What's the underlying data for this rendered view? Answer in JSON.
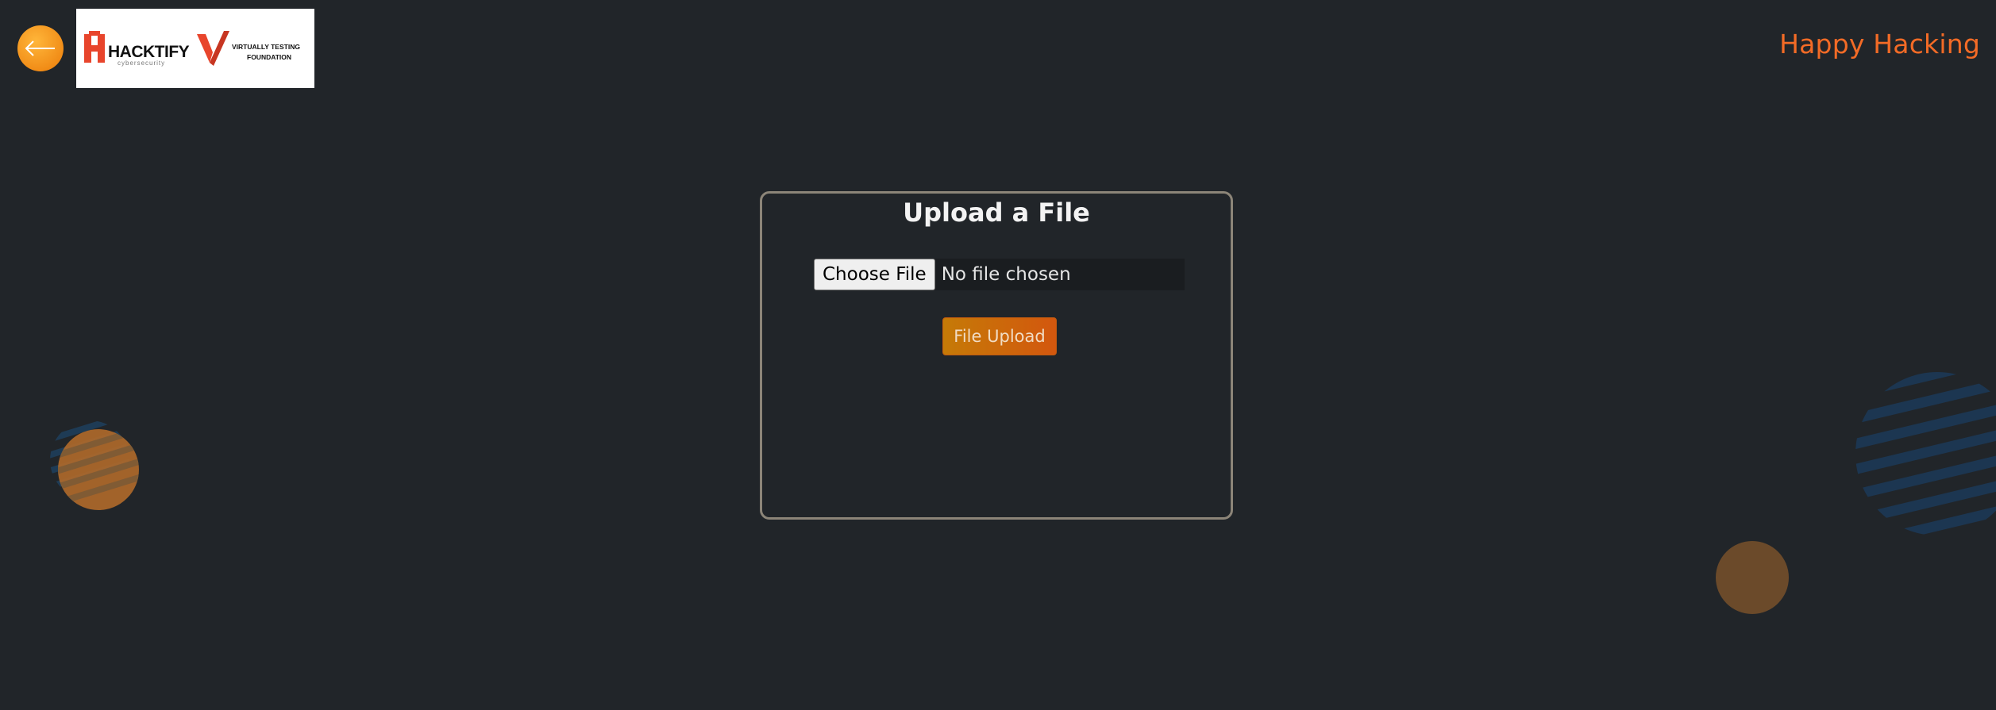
{
  "header": {
    "back_icon": "arrow-left-icon",
    "logo": {
      "brand_name": "HACKTIFY",
      "brand_tagline": "cybersecurity",
      "partner_line1": "VIRTUALLY TESTING",
      "partner_line2": "FOUNDATION"
    },
    "tagline": "Happy Hacking"
  },
  "upload_card": {
    "title": "Upload a File",
    "choose_button_label": "Choose File",
    "file_status": "No file chosen",
    "upload_button_label": "File Upload"
  },
  "colors": {
    "background": "#212529",
    "accent_orange": "#f36b26",
    "card_border": "#8c8578",
    "button_gradient_start": "#c57a07",
    "button_gradient_end": "#d3570e"
  }
}
